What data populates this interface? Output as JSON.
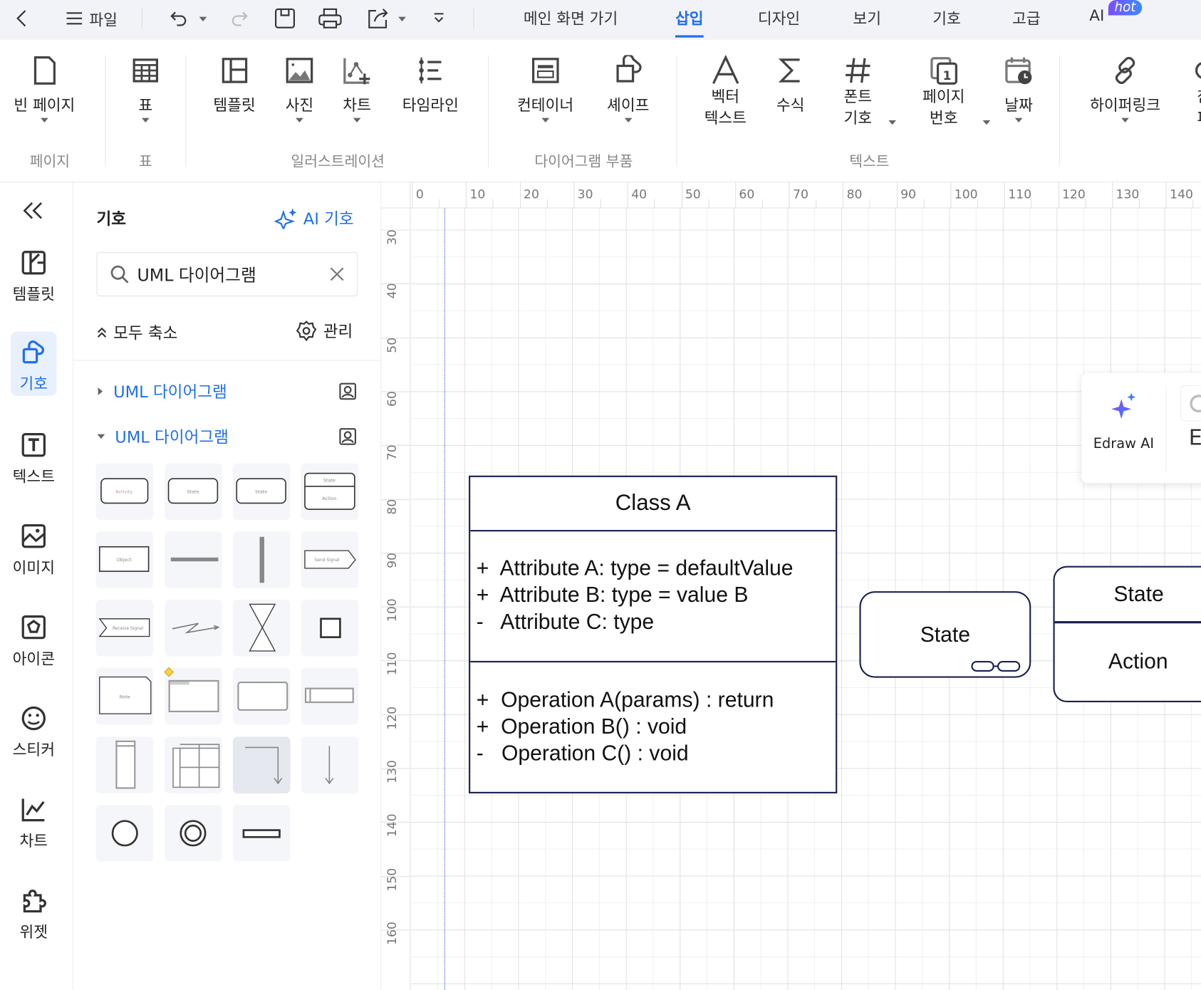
{
  "topbar": {
    "file": "파일",
    "tabs": [
      {
        "label": "메인 화면 가기"
      },
      {
        "label": "삽입",
        "active": true
      },
      {
        "label": "디자인"
      },
      {
        "label": "보기"
      },
      {
        "label": "기호"
      },
      {
        "label": "고급"
      },
      {
        "label": "AI"
      }
    ],
    "hot_badge": "hot",
    "accent": "#1f6feb"
  },
  "ribbon": {
    "items": [
      {
        "label": "빈 페이지",
        "icon": "blank-page-icon"
      },
      {
        "label": "표",
        "icon": "table-icon"
      },
      {
        "label": "템플릿",
        "icon": "template-icon"
      },
      {
        "label": "사진",
        "icon": "image-icon"
      },
      {
        "label": "차트",
        "icon": "chart-icon"
      },
      {
        "label": "타임라인",
        "icon": "timeline-icon"
      },
      {
        "label": "컨테이너",
        "icon": "container-icon"
      },
      {
        "label": "셰이프",
        "icon": "shape-icon"
      },
      {
        "label": "벡터\n텍스트",
        "icon": "vector-text-icon"
      },
      {
        "label": "수식",
        "icon": "sigma-icon"
      },
      {
        "label": "폰트\n기호",
        "icon": "hash-icon"
      },
      {
        "label": "페이지\n번호",
        "icon": "page-number-icon"
      },
      {
        "label": "날짜",
        "icon": "calendar-icon"
      },
      {
        "label": "하이퍼링크",
        "icon": "link-icon"
      },
      {
        "label": "참\n피",
        "icon": "partial-icon"
      }
    ],
    "groups": [
      "페이지",
      "표",
      "일러스트레이션",
      "다이어그램 부품",
      "텍스트"
    ]
  },
  "leftnav": {
    "items": [
      {
        "label": "템플릿"
      },
      {
        "label": "기호",
        "active": true
      },
      {
        "label": "텍스트"
      },
      {
        "label": "이미지"
      },
      {
        "label": "아이콘"
      },
      {
        "label": "스티커"
      },
      {
        "label": "차트"
      },
      {
        "label": "위젯"
      }
    ]
  },
  "panel": {
    "title": "기호",
    "ai_symbols": "AI 기호",
    "search_value": "UML 다이어그램",
    "collapse_all": "모두 축소",
    "manage": "관리",
    "libraries": [
      {
        "name": "UML 다이어그램",
        "expanded": false
      },
      {
        "name": "UML 다이어그램",
        "expanded": true
      }
    ],
    "tile_labels": {
      "activity": "Activity",
      "state": "State",
      "action": "Action",
      "object": "Object",
      "send": "Send Signal",
      "receive": "Receive Signal",
      "note": "Note"
    }
  },
  "ruler": {
    "h": [
      "0",
      "10",
      "20",
      "30",
      "40",
      "50",
      "60",
      "70",
      "80",
      "90",
      "100",
      "110",
      "120",
      "130",
      "140"
    ],
    "v": [
      "30",
      "40",
      "50",
      "60",
      "70",
      "80",
      "90",
      "100",
      "110",
      "120",
      "130",
      "140",
      "150",
      "160"
    ]
  },
  "diagram": {
    "class": {
      "name": "Class A",
      "attributes": [
        {
          "vis": "+",
          "text": "Attribute A: type = defaultValue"
        },
        {
          "vis": "+",
          "text": "Attribute B: type = value B"
        },
        {
          "vis": "-",
          "text": "Attribute C: type"
        }
      ],
      "operations": [
        {
          "vis": "+",
          "text": "Operation A(params) : return"
        },
        {
          "vis": "+",
          "text": "Operation B() : void"
        },
        {
          "vis": "-",
          "text": "Operation C() : void"
        }
      ]
    },
    "state": "State",
    "state_action": {
      "state": "State",
      "action": "Action"
    }
  },
  "ai_popup": {
    "label": "Edraw AI",
    "next": "E"
  }
}
